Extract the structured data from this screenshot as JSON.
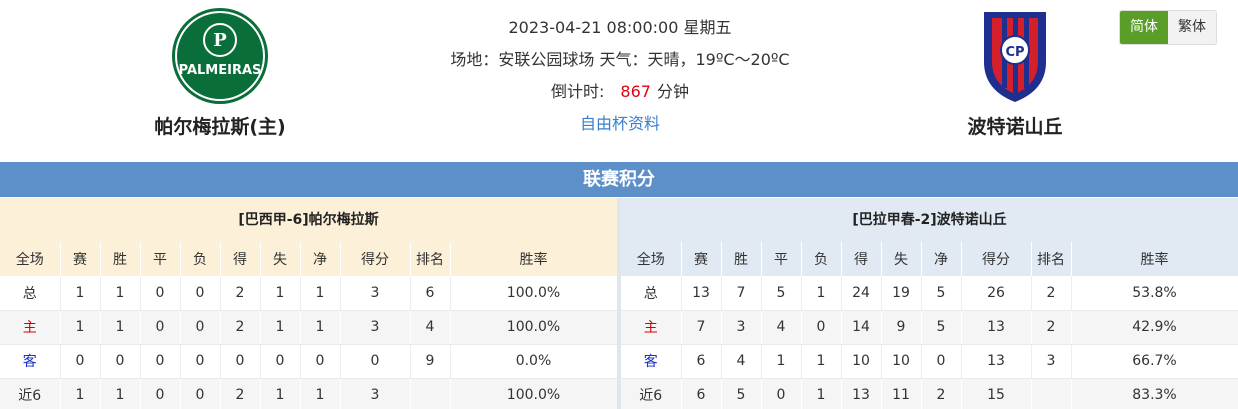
{
  "match": {
    "datetime": "2023-04-21 08:00:00 星期五",
    "venue_line": "场地：安联公园球场 天气：天晴，19ºC～20ºC",
    "countdown_label": "倒计时:",
    "countdown_value": "867",
    "countdown_unit": "分钟",
    "cup_link": "自由杯资料"
  },
  "home_team": {
    "name": "帕尔梅拉斯(主)",
    "logo_icon": "palmeiras-crest-icon"
  },
  "away_team": {
    "name": "波特诺山丘",
    "logo_icon": "cerro-porteno-crest-icon"
  },
  "lang": {
    "simplified": "简体",
    "traditional": "繁体"
  },
  "standings": {
    "title": "联赛积分",
    "columns": [
      "全场",
      "赛",
      "胜",
      "平",
      "负",
      "得",
      "失",
      "净",
      "得分",
      "排名",
      "胜率"
    ],
    "home": {
      "header": "[巴西甲-6]帕尔梅拉斯",
      "rows": [
        [
          "总",
          "1",
          "1",
          "0",
          "0",
          "2",
          "1",
          "1",
          "3",
          "6",
          "100.0%"
        ],
        [
          "主",
          "1",
          "1",
          "0",
          "0",
          "2",
          "1",
          "1",
          "3",
          "4",
          "100.0%"
        ],
        [
          "客",
          "0",
          "0",
          "0",
          "0",
          "0",
          "0",
          "0",
          "0",
          "9",
          "0.0%"
        ],
        [
          "近6",
          "1",
          "1",
          "0",
          "0",
          "2",
          "1",
          "1",
          "3",
          "",
          "100.0%"
        ]
      ]
    },
    "away": {
      "header": "[巴拉甲春-2]波特诺山丘",
      "rows": [
        [
          "总",
          "13",
          "7",
          "5",
          "1",
          "24",
          "19",
          "5",
          "26",
          "2",
          "53.8%"
        ],
        [
          "主",
          "7",
          "3",
          "4",
          "0",
          "14",
          "9",
          "5",
          "13",
          "2",
          "42.9%"
        ],
        [
          "客",
          "6",
          "4",
          "1",
          "1",
          "10",
          "10",
          "0",
          "13",
          "3",
          "66.7%"
        ],
        [
          "近6",
          "6",
          "5",
          "0",
          "1",
          "13",
          "11",
          "2",
          "15",
          "",
          "83.3%"
        ]
      ]
    }
  },
  "colors": {
    "accent_blue": "#5d8fc9",
    "home_red": "#d60000",
    "away_blue": "#1a2fc5",
    "countdown_red": "#e60012",
    "active_green": "#5a9e28"
  }
}
